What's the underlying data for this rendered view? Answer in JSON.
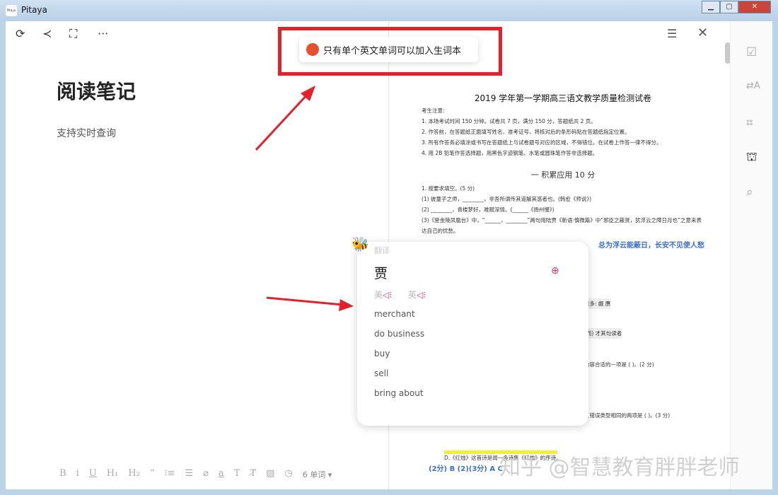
{
  "window": {
    "title": "Pitaya",
    "logo_text": "Pitaya"
  },
  "left_toolbar": {
    "icons": [
      "refresh-icon",
      "share-icon",
      "fullscreen-icon",
      "more-icon"
    ],
    "more": "···"
  },
  "note": {
    "title": "阅读笔记",
    "body": "支持实时查询"
  },
  "format_bar": {
    "items": [
      "B",
      "i",
      "U",
      "H₁",
      "H₂",
      "“",
      "⁝≡",
      "☰",
      "⌀",
      "a",
      "T",
      "T̸",
      "▨",
      "◷"
    ],
    "word_count": "6 单词 ▾"
  },
  "toast": {
    "message": "只有单个英文单词可以加入生词本",
    "color": "#e8502c"
  },
  "doc": {
    "title": "2019 学年第一学期高三语文教学质量检测试卷",
    "notice_head": "考生注意:",
    "notices": [
      "1. 本场考试时间 150 分钟。试卷共 7 页，满分 150 分，答题纸共 2 页。",
      "2. 作答前，在答题纸正面填写姓名、准考证号，将核对后的条形码贴在答题纸指定位置。",
      "3. 所有作答务必填涂或书写在答题纸上与试卷题号对应的区域，不得错位。在试卷上作答一律不得分。",
      "4. 用 2B 铅笔作答选择题，用黑色字迹钢笔、水笔或圆珠笔作答非选择题。"
    ],
    "section": "一  积累应用  10 分",
    "q1": "1. 按要求填空。(5 分)",
    "q1_items": [
      "(1) 彼童子之师，________，非吾所谓传其道解其惑者也。(韩愈《师说》)",
      "(2) ________，青楼梦好，难赋深情。(______《扬州慢》)",
      "(3)《登金陵凤凰台》中，“______，________”两句用陆贾《新语·慎微篇》中“邪臣之蔽贤，犹浮云之障日月也”之意来表达自己的忧愁。"
    ],
    "answer_line": "总为浮云能蔽日，长安不见使人愁",
    "fragments": [
      "读多: 觑  赝",
      "(而) 才其句读者",
      "内容合适的一项是 ( )。(2 分)",
      "且错误类型相同的两项是 ( )。(3 分)"
    ],
    "line_d": "D.《红烛》这首诗是闻一多诗集《红烛》的序诗。",
    "answers": "(2分) B  (2)(3分) A C"
  },
  "right_rail": {
    "icons": [
      "check-doc-icon",
      "translate-icon",
      "flow-icon",
      "hat-icon",
      "search-doc-icon"
    ]
  },
  "popup": {
    "label": "翻译",
    "word": "贾",
    "us": "美",
    "uk": "英",
    "meanings": [
      "merchant",
      "do business",
      "buy",
      "sell",
      "bring about"
    ],
    "accent": "#d0356b"
  },
  "watermark": "知乎 @智慧教育胖胖老师"
}
